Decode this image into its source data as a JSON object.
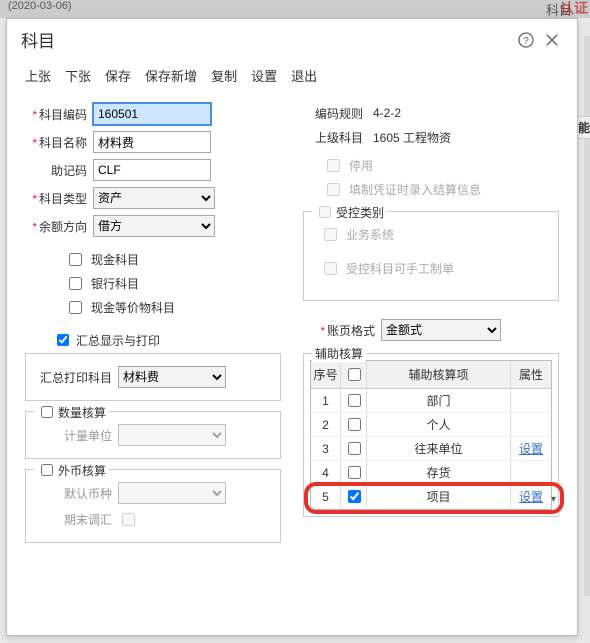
{
  "bg": {
    "date": "(2020-03-06)",
    "rightBg": "科目",
    "watermark": "认证"
  },
  "dialog": {
    "title": "科目"
  },
  "menu": [
    "上张",
    "下张",
    "保存",
    "保存新增",
    "复制",
    "设置",
    "退出"
  ],
  "left": {
    "codeLabel": "科目编码",
    "codeValue": "160501",
    "nameLabel": "科目名称",
    "nameValue": "材料费",
    "mnemonicLabel": "助记码",
    "mnemonicValue": "CLF",
    "typeLabel": "科目类型",
    "typeValue": "资产",
    "directionLabel": "余额方向",
    "directionValue": "借方",
    "cashLabel": "现金科目",
    "bankLabel": "银行科目",
    "cashEquivLabel": "现金等价物科目",
    "summaryLabel": "汇总显示与打印",
    "summarySubLabel": "汇总打印科目",
    "summarySubValue": "材料费",
    "qtyTitle": "数量核算",
    "qtyUnitLabel": "计量单位",
    "ccyTitle": "外币核算",
    "ccyDefaultLabel": "默认币种",
    "ccyAdjustLabel": "期末调汇"
  },
  "right": {
    "ruleLabel": "编码规则",
    "ruleValue": "4-2-2",
    "parentLabel": "上级科目",
    "parentValue": "1605 工程物资",
    "disableLabel": "停用",
    "voucherLockLabel": "填制凭证时录入结算信息",
    "ctrlTitle": "受控类别",
    "bizLabel": "业务系统",
    "manualLabel": "受控科目可手工制单",
    "formatLabel": "账页格式",
    "formatValue": "金额式",
    "auxTitle": "辅助核算",
    "auxHead": {
      "idx": "序号",
      "name": "辅助核算项",
      "attr": "属性"
    },
    "auxRows": [
      {
        "idx": "1",
        "checked": false,
        "name": "部门",
        "link": ""
      },
      {
        "idx": "2",
        "checked": false,
        "name": "个人",
        "link": ""
      },
      {
        "idx": "3",
        "checked": false,
        "name": "往来单位",
        "link": "设置"
      },
      {
        "idx": "4",
        "checked": false,
        "name": "存货",
        "link": ""
      },
      {
        "idx": "5",
        "checked": true,
        "name": "项目",
        "link": "设置"
      }
    ]
  },
  "sideLabel": "功能"
}
